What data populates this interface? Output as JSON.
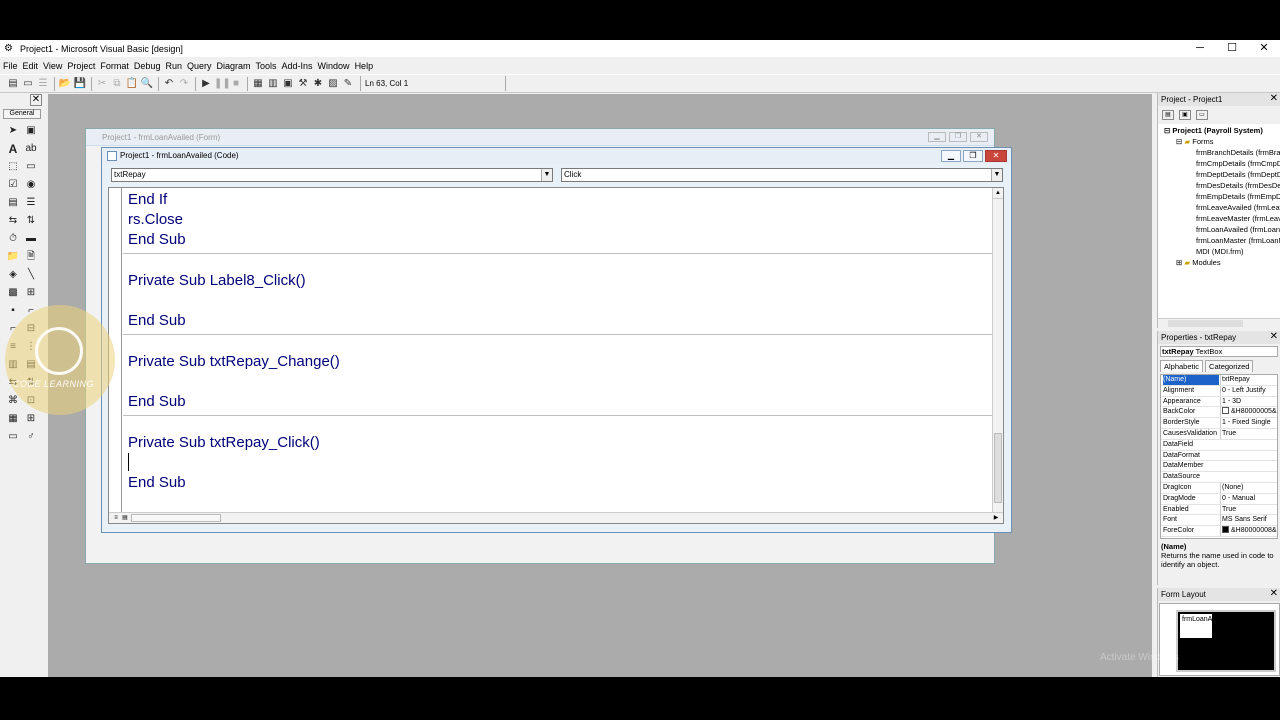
{
  "window": {
    "title": "Project1 - Microsoft Visual Basic [design]",
    "minimize": "─",
    "maximize": "☐",
    "close": "✕"
  },
  "menu": [
    "File",
    "Edit",
    "View",
    "Project",
    "Format",
    "Debug",
    "Run",
    "Query",
    "Diagram",
    "Tools",
    "Add-Ins",
    "Window",
    "Help"
  ],
  "toolbar": {
    "position": "Ln 63, Col 1"
  },
  "toolbox": {
    "tab": "General",
    "close": "✕"
  },
  "form_window": {
    "title": "Project1 - frmLoanAvailed (Form)"
  },
  "code_window": {
    "title": "Project1 - frmLoanAvailed (Code)",
    "object_combo": "txtRepay",
    "proc_combo": "Click",
    "lines": [
      "End If",
      "rs.Close",
      "End Sub",
      "Private Sub Label8_Click()",
      "End Sub",
      "Private Sub txtRepay_Change()",
      "End Sub",
      "Private Sub txtRepay_Click()",
      "End Sub"
    ]
  },
  "watermark": {
    "brand": "CODE LEARNING"
  },
  "project_explorer": {
    "title": "Project - Project1",
    "root": "Project1 (Payroll System)",
    "forms_folder": "Forms",
    "forms": [
      "frmBranchDetails (frmBranchDetails.frm)",
      "frmCmpDetails (frmCmpDetails.frm)",
      "frmDeptDetails (frmDeptDetails.frm)",
      "frmDesDetails (frmDesDetails.frm)",
      "frmEmpDetails (frmEmpDetails.frm)",
      "frmLeaveAvailed (frmLeaveAvailed.frm)",
      "frmLeaveMaster (frmLeaveMaster.frm)",
      "frmLoanAvailed (frmLoanAvailed.frm)",
      "frmLoanMaster (frmLoanMaster.frm)",
      "MDI (MDI.frm)"
    ],
    "modules_folder": "Modules"
  },
  "properties": {
    "title": "Properties - txtRepay",
    "object": "txtRepay",
    "object_type": "TextBox",
    "tabs": [
      "Alphabetic",
      "Categorized"
    ],
    "rows": [
      {
        "name": "(Name)",
        "value": "txtRepay"
      },
      {
        "name": "Alignment",
        "value": "0 - Left Justify"
      },
      {
        "name": "Appearance",
        "value": "1 - 3D"
      },
      {
        "name": "BackColor",
        "value": "&H80000005&"
      },
      {
        "name": "BorderStyle",
        "value": "1 - Fixed Single"
      },
      {
        "name": "CausesValidation",
        "value": "True"
      },
      {
        "name": "DataField",
        "value": ""
      },
      {
        "name": "DataFormat",
        "value": ""
      },
      {
        "name": "DataMember",
        "value": ""
      },
      {
        "name": "DataSource",
        "value": ""
      },
      {
        "name": "DragIcon",
        "value": "(None)"
      },
      {
        "name": "DragMode",
        "value": "0 - Manual"
      },
      {
        "name": "Enabled",
        "value": "True"
      },
      {
        "name": "Font",
        "value": "MS Sans Serif"
      },
      {
        "name": "ForeColor",
        "value": "&H80000008&"
      }
    ],
    "desc_title": "(Name)",
    "desc_text": "Returns the name used in code to identify an object."
  },
  "form_layout": {
    "title": "Form Layout",
    "mini_form": "frmLoanA"
  },
  "activation": {
    "text": "Activate Windows"
  },
  "colors": {
    "code_text": "#00007a",
    "mdi_bg": "#ababab",
    "close_red": "#c9463d",
    "selection": "#1c62c8"
  }
}
